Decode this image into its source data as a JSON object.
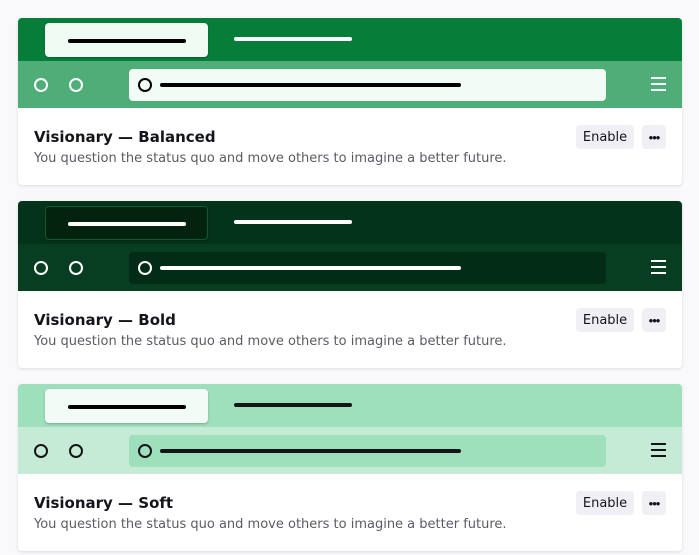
{
  "themes": [
    {
      "title": "Visionary — Balanced",
      "description": "You question the status quo and move others to imagine a better future.",
      "enable_label": "Enable",
      "more_label": "•••",
      "colors": {
        "tabstrip": "#077d3a",
        "active_tab": "#f0fbf4",
        "active_tab_line": "#000000",
        "inactive_tab_line": "#ffffff",
        "toolbar": "#4fad77",
        "toolbar_icon": "#ffffff",
        "urlbar": "#f2fbf5",
        "urlbar_text": "#000000",
        "tab_border": "transparent"
      }
    },
    {
      "title": "Visionary — Bold",
      "description": "You question the status quo and move others to imagine a better future.",
      "enable_label": "Enable",
      "more_label": "•••",
      "colors": {
        "tabstrip": "#04331b",
        "active_tab": "#03230f",
        "active_tab_line": "#ffffff",
        "inactive_tab_line": "#ffffff",
        "toolbar": "#073d21",
        "toolbar_icon": "#ffffff",
        "urlbar": "#032c16",
        "urlbar_text": "#ffffff",
        "tab_border": "#0f5a30"
      }
    },
    {
      "title": "Visionary — Soft",
      "description": "You question the status quo and move others to imagine a better future.",
      "enable_label": "Enable",
      "more_label": "•••",
      "colors": {
        "tabstrip": "#9ee0bb",
        "active_tab": "#f2fbf5",
        "active_tab_line": "#000000",
        "inactive_tab_line": "#15141a",
        "toolbar": "#c5ebd6",
        "toolbar_icon": "#15141a",
        "urlbar": "#9ee0bb",
        "urlbar_text": "#15141a",
        "tab_border": "transparent"
      }
    }
  ]
}
